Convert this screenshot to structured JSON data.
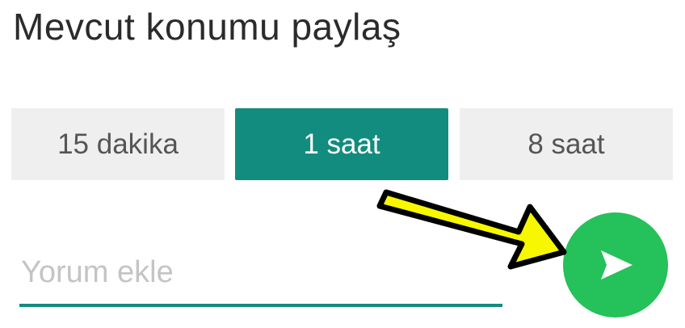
{
  "header": {
    "title": "Mevcut konumu paylaş"
  },
  "duration_options": [
    {
      "label": "15 dakika",
      "selected": false
    },
    {
      "label": "1 saat",
      "selected": true
    },
    {
      "label": "8 saat",
      "selected": false
    }
  ],
  "comment": {
    "placeholder": "Yorum ekle",
    "value": ""
  },
  "send_button": {
    "icon": "send-icon"
  },
  "colors": {
    "accent": "#128c7e",
    "send": "#25c15a",
    "inactive_bg": "#efefef",
    "annotation_arrow": "#f7f700"
  }
}
